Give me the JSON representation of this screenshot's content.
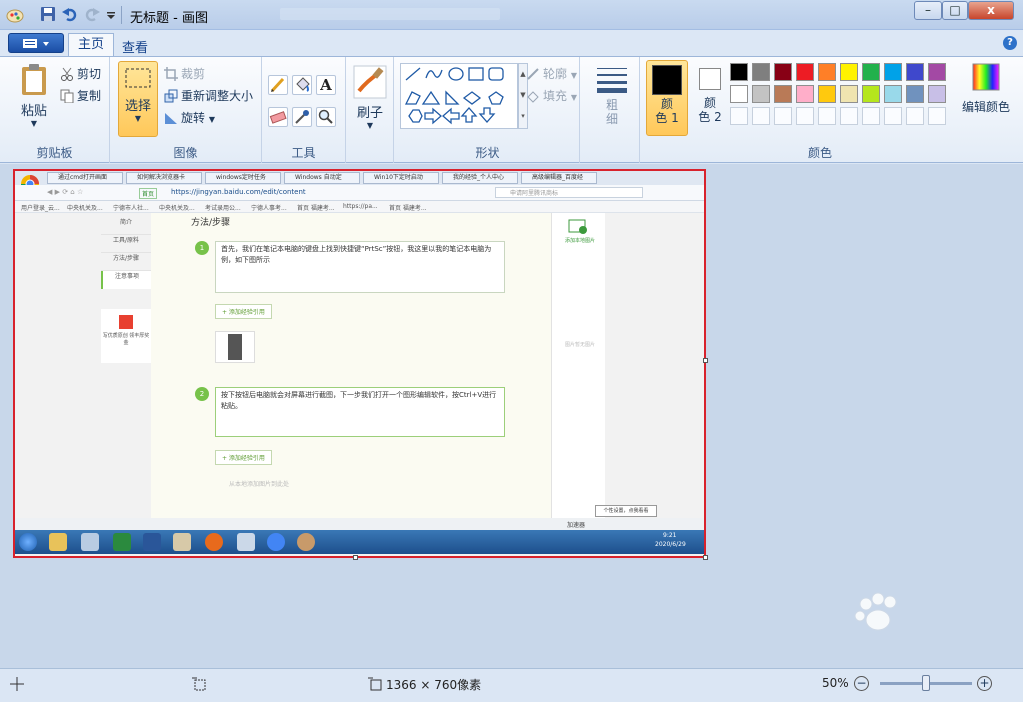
{
  "window": {
    "title": "无标题 - 画图",
    "minimize": "–",
    "maximize": "□",
    "close": "x"
  },
  "tabs": {
    "home": "主页",
    "view": "查看",
    "help": "?"
  },
  "ribbon": {
    "clipboard": {
      "label": "剪贴板",
      "paste": "粘贴",
      "cut": "剪切",
      "copy": "复制"
    },
    "image": {
      "label": "图像",
      "select": "选择",
      "crop": "裁剪",
      "resize": "重新调整大小",
      "rotate": "旋转"
    },
    "tools": {
      "label": "工具",
      "text_tool": "A"
    },
    "brushes": {
      "label": "刷子"
    },
    "shapes": {
      "label": "形状",
      "outline": "轮廓",
      "fill": "填充"
    },
    "size": {
      "label": "粗\n细"
    },
    "colors": {
      "label": "颜色",
      "color1": "颜\n色 1",
      "color2": "颜\n色 2",
      "edit": "编辑颜色",
      "color1_value": "#000000",
      "color2_value": "#ffffff",
      "palette_row1": [
        "#000000",
        "#7f7f7f",
        "#880015",
        "#ed1c24",
        "#ff7f27",
        "#fff200",
        "#22b14c",
        "#00a2e8",
        "#3f48cc",
        "#a349a4"
      ],
      "palette_row2": [
        "#ffffff",
        "#c3c3c3",
        "#b97a57",
        "#ffaec9",
        "#ffc90e",
        "#efe4b0",
        "#b5e61d",
        "#99d9ea",
        "#7092be",
        "#c8bfe7"
      ]
    }
  },
  "canvas_content": {
    "browser_tabs": [
      "通过cmd打开画面",
      "如何解决浏览器卡",
      "windows定时任务",
      "Windows 自动定",
      "Win10下定时启动",
      "我的经验_个人中心",
      "高级编辑器_百度经"
    ],
    "url_label": "首页",
    "url": "https://jingyan.baidu.com/edit/content",
    "search_placeholder": "申请阿里腾讯商标",
    "bookmarks": [
      "用户登录_云...",
      "中央机关及...",
      "宁德市人社...",
      "中央机关及...",
      "考试录用公...",
      "宁德人事考...",
      "首页 福建考...",
      "https://pa...",
      "首页 福建考..."
    ],
    "left_nav": [
      "简介",
      "工具/原料",
      "方法/步骤",
      "注意事项"
    ],
    "promo": "写优质原创 领丰厚奖金",
    "section_title": "方法/步骤",
    "step1_num": "1",
    "step1_text": "首先，我们在笔记本电脑的键盘上找到快捷键“PrtSc”按钮，我这里以我的笔记本电脑为例，如下图所示",
    "step2_num": "2",
    "step2_text": "按下按钮后电脑就会对屏幕进行截图，下一步我们打开一个图形编辑软件，按Ctrl+V进行粘贴。",
    "add_ref": "+ 添加经验引用",
    "add_from_image": "从本地添加图片到此处",
    "add_local_image": "添加本地图片",
    "no_image": "图片暂无图片",
    "tooltip": "个性设置，点我看看",
    "accelerator": "加速器",
    "time": "9:21",
    "date": "2020/6/29"
  },
  "statusbar": {
    "image_size": "1366 × 760像素",
    "zoom": "50%",
    "zoom_level": 0.5
  }
}
